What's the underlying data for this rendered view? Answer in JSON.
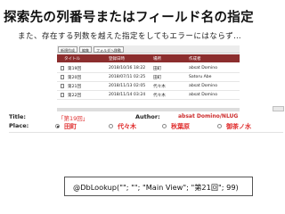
{
  "headline": "探索先の列番号またはフィールド名の指定",
  "subline": "また、存在する列数を越えた指定をしてもエラーにはならず…",
  "view": {
    "toolbar": [
      {
        "label": "新規作成"
      },
      {
        "label": "編集"
      },
      {
        "label": "フォルダへ移動"
      }
    ],
    "columns": [
      "タイトル",
      "登録日時",
      "場所",
      "作成者"
    ],
    "rows": [
      [
        "第19回",
        "2018/10/16 18:22",
        "田町",
        "absat Domino"
      ],
      [
        "第20回",
        "2018/07/11 02:25",
        "田町",
        "Satoru Abe"
      ],
      [
        "第21回",
        "2018/11/13 02:05",
        "代々木",
        "absat Domino"
      ],
      [
        "第22回",
        "2018/11/14 03:24",
        "代々木",
        "absat Domino"
      ]
    ]
  },
  "form": {
    "title_label": "Title:",
    "title_value": "「第19回」",
    "author_label": "Author:",
    "author_value": "absat Domino/NLUG",
    "place_label": "Place:",
    "place_options": [
      {
        "label": "田町",
        "selected": true
      },
      {
        "label": "代々木",
        "selected": false
      },
      {
        "label": "秋葉原",
        "selected": false
      },
      {
        "label": "御茶ノ水",
        "selected": false
      }
    ]
  },
  "formula": "@DbLookup(\"\"; \"\"; \"Main View\"; \"第21回\"; 99)",
  "colors": {
    "header_bg": "#8c2e2e",
    "accent_red": "#e03030"
  }
}
